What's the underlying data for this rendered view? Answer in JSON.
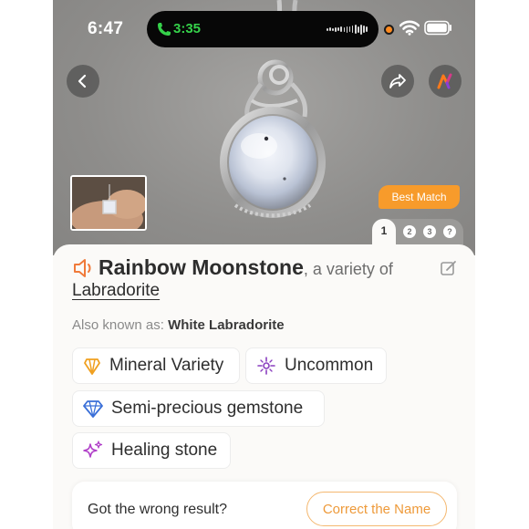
{
  "status_bar": {
    "time": "6:47",
    "call_time": "3:35",
    "recording_color": "#ff8a1f"
  },
  "hero": {
    "back_icon": "chevron-left-icon",
    "share_icon": "share-arrow-icon",
    "app_icon": "app-logo-icon",
    "badge": "Best Match",
    "pager": {
      "active": "1",
      "pages": [
        "2",
        "3",
        "?"
      ]
    }
  },
  "result": {
    "name": "Rainbow Moonstone",
    "variety_text": ", a variety of",
    "parent": "Labradorite",
    "aka_label": "Also known as:",
    "aka_value": "White Labradorite",
    "tags": [
      {
        "label": "Mineral Variety",
        "icon": "crystal-icon",
        "color": "#f0a020"
      },
      {
        "label": "Uncommon",
        "icon": "sparkle-icon",
        "color": "#8a3fbf"
      },
      {
        "label": "Semi-precious gemstone",
        "icon": "diamond-icon",
        "color": "#3a6fd8"
      },
      {
        "label": "Healing stone",
        "icon": "twinkle-stars-icon",
        "color": "#b03fc8"
      }
    ]
  },
  "feedback": {
    "question": "Got the wrong result?",
    "button": "Correct the Name",
    "accent": "#ee9a3a"
  }
}
